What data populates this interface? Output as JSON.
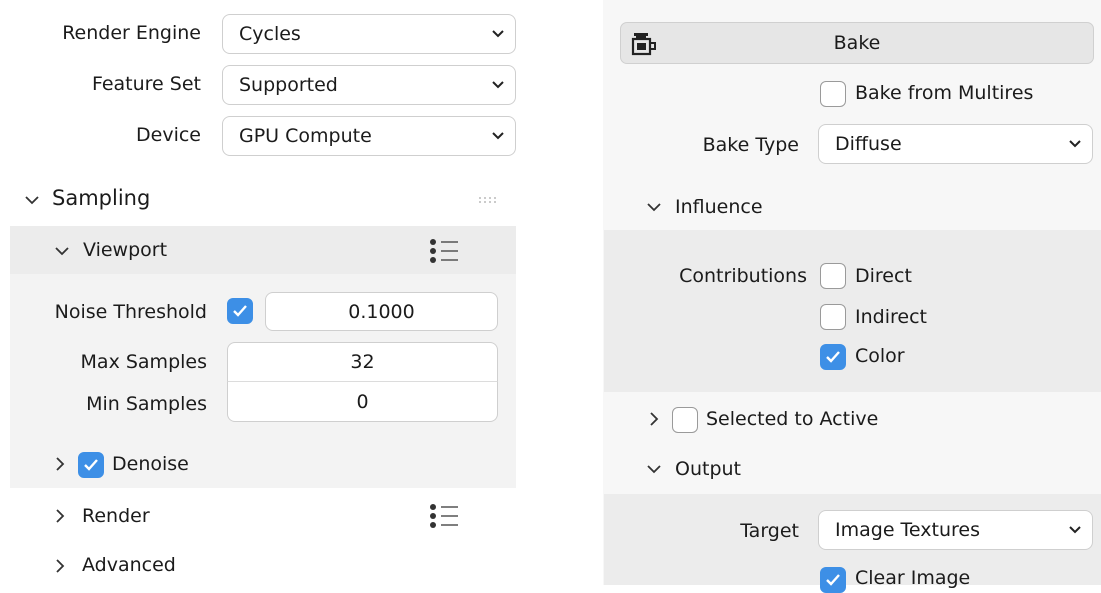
{
  "left": {
    "render_engine": {
      "label": "Render Engine",
      "value": "Cycles"
    },
    "feature_set": {
      "label": "Feature Set",
      "value": "Supported"
    },
    "device": {
      "label": "Device",
      "value": "GPU Compute"
    },
    "sampling": {
      "title": "Sampling",
      "viewport": {
        "title": "Viewport",
        "noise_threshold": {
          "label": "Noise Threshold",
          "enabled": true,
          "value": "0.1000"
        },
        "max_samples": {
          "label": "Max Samples",
          "value": "32"
        },
        "min_samples": {
          "label": "Min Samples",
          "value": "0"
        },
        "denoise": {
          "label": "Denoise",
          "enabled": true
        }
      },
      "render": {
        "title": "Render"
      },
      "advanced": {
        "title": "Advanced"
      }
    }
  },
  "right": {
    "bake_button": {
      "label": "Bake",
      "icon": "bake-icon"
    },
    "bake_from_multires": {
      "label": "Bake from Multires",
      "checked": false
    },
    "bake_type": {
      "label": "Bake Type",
      "value": "Diffuse"
    },
    "influence": {
      "title": "Influence",
      "contributions_label": "Contributions",
      "direct": {
        "label": "Direct",
        "checked": false
      },
      "indirect": {
        "label": "Indirect",
        "checked": false
      },
      "color": {
        "label": "Color",
        "checked": true
      }
    },
    "selected_to_active": {
      "label": "Selected to Active",
      "checked": false
    },
    "output": {
      "title": "Output",
      "target": {
        "label": "Target",
        "value": "Image Textures"
      },
      "clear_image": {
        "label": "Clear Image",
        "checked": true
      }
    }
  },
  "colors": {
    "accent": "#3d8fe6",
    "panel": "#efefef"
  }
}
